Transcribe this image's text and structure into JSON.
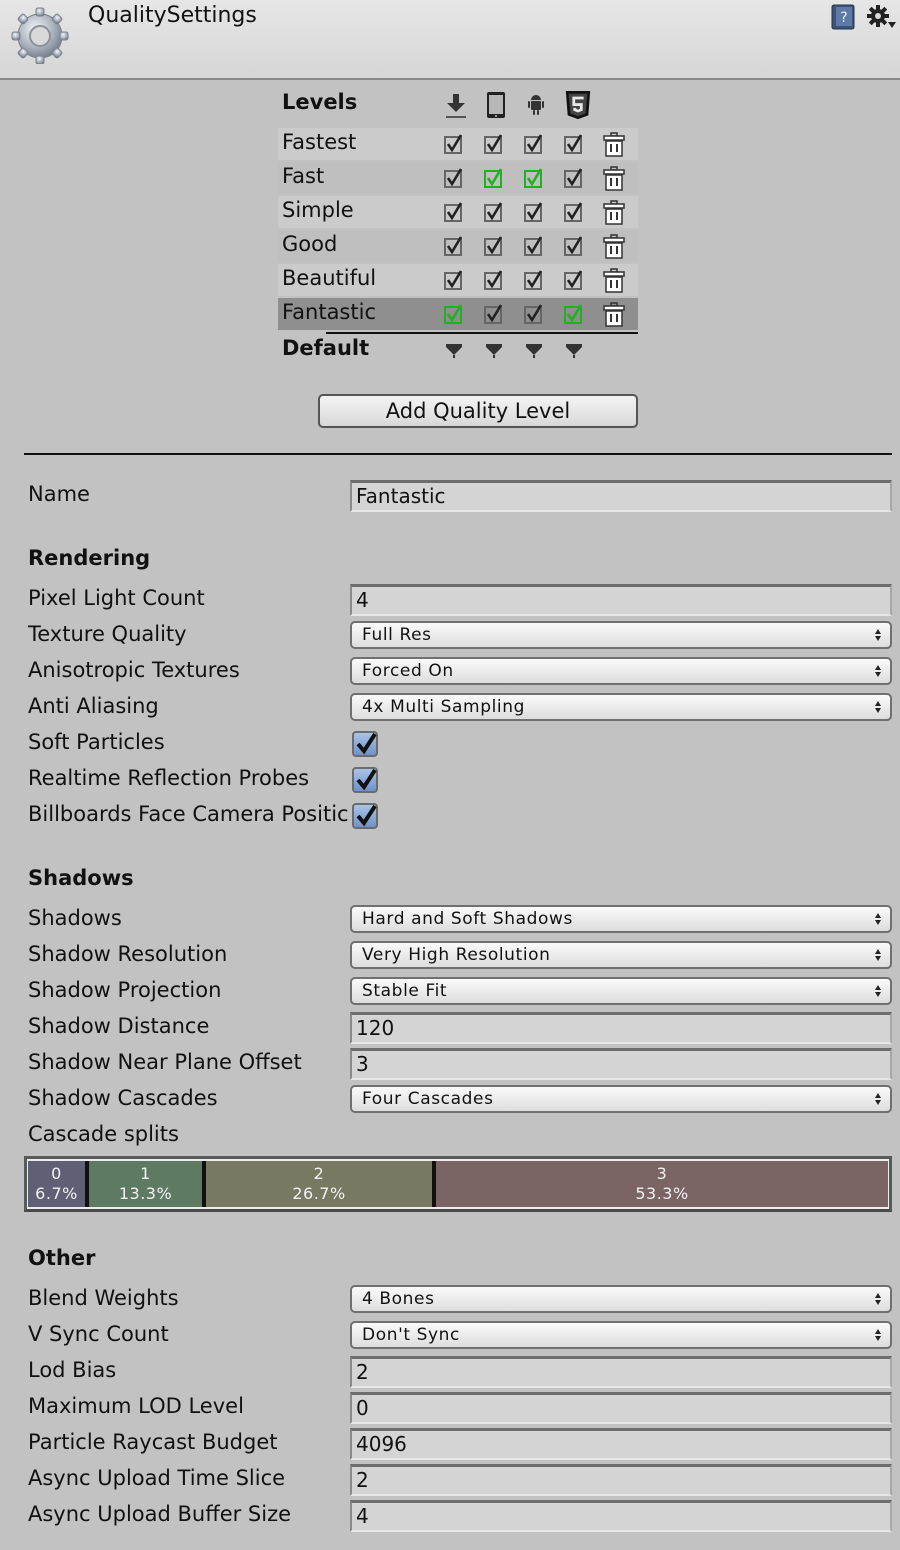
{
  "header": {
    "title": "QualitySettings",
    "icons": [
      "gear-icon",
      "help-book-icon",
      "settings-gear-dropdown-icon"
    ]
  },
  "levels": {
    "header_label": "Levels",
    "platforms": [
      {
        "name": "standalone",
        "icon": "download-arrow-icon"
      },
      {
        "name": "ios",
        "icon": "phone-icon"
      },
      {
        "name": "android",
        "icon": "android-icon"
      },
      {
        "name": "webgl",
        "icon": "html5-icon"
      }
    ],
    "rows": [
      {
        "name": "Fastest",
        "checks": [
          true,
          true,
          true,
          true
        ],
        "green": [
          false,
          false,
          false,
          false
        ],
        "selected": false
      },
      {
        "name": "Fast",
        "checks": [
          true,
          true,
          true,
          true
        ],
        "green": [
          false,
          true,
          true,
          false
        ],
        "selected": false
      },
      {
        "name": "Simple",
        "checks": [
          true,
          true,
          true,
          true
        ],
        "green": [
          false,
          false,
          false,
          false
        ],
        "selected": false
      },
      {
        "name": "Good",
        "checks": [
          true,
          true,
          true,
          true
        ],
        "green": [
          false,
          false,
          false,
          false
        ],
        "selected": false
      },
      {
        "name": "Beautiful",
        "checks": [
          true,
          true,
          true,
          true
        ],
        "green": [
          false,
          false,
          false,
          false
        ],
        "selected": false
      },
      {
        "name": "Fantastic",
        "checks": [
          true,
          true,
          true,
          true
        ],
        "green": [
          true,
          false,
          false,
          true
        ],
        "selected": true
      }
    ],
    "default_label": "Default",
    "add_button": "Add Quality Level"
  },
  "colors": {
    "default_check": "#222222",
    "highlight_check": "#22b022",
    "cascade": [
      "#5f5f75",
      "#5f7a62",
      "#797963",
      "#7a6464"
    ]
  },
  "name": {
    "label": "Name",
    "value": "Fantastic"
  },
  "rendering": {
    "title": "Rendering",
    "pixel_light_count": {
      "label": "Pixel Light Count",
      "value": "4"
    },
    "texture_quality": {
      "label": "Texture Quality",
      "value": "Full Res"
    },
    "anisotropic_textures": {
      "label": "Anisotropic Textures",
      "value": "Forced On"
    },
    "anti_aliasing": {
      "label": "Anti Aliasing",
      "value": "4x Multi Sampling"
    },
    "soft_particles": {
      "label": "Soft Particles",
      "checked": true
    },
    "realtime_reflection_probes": {
      "label": "Realtime Reflection Probes",
      "checked": true
    },
    "billboards_face_camera": {
      "label": "Billboards Face Camera Positic",
      "checked": true
    }
  },
  "shadows": {
    "title": "Shadows",
    "shadows": {
      "label": "Shadows",
      "value": "Hard and Soft Shadows"
    },
    "shadow_resolution": {
      "label": "Shadow Resolution",
      "value": "Very High Resolution"
    },
    "shadow_projection": {
      "label": "Shadow Projection",
      "value": "Stable Fit"
    },
    "shadow_distance": {
      "label": "Shadow Distance",
      "value": "120"
    },
    "shadow_near_plane_offset": {
      "label": "Shadow Near Plane Offset",
      "value": "3"
    },
    "shadow_cascades": {
      "label": "Shadow Cascades",
      "value": "Four Cascades"
    },
    "cascade_splits": {
      "label": "Cascade splits",
      "segments": [
        {
          "index": "0",
          "percent_label": "6.7%",
          "fraction": 0.067
        },
        {
          "index": "1",
          "percent_label": "13.3%",
          "fraction": 0.133
        },
        {
          "index": "2",
          "percent_label": "26.7%",
          "fraction": 0.267
        },
        {
          "index": "3",
          "percent_label": "53.3%",
          "fraction": 0.533
        }
      ]
    }
  },
  "other": {
    "title": "Other",
    "blend_weights": {
      "label": "Blend Weights",
      "value": "4 Bones"
    },
    "v_sync_count": {
      "label": "V Sync Count",
      "value": "Don't Sync"
    },
    "lod_bias": {
      "label": "Lod Bias",
      "value": "2"
    },
    "maximum_lod_level": {
      "label": "Maximum LOD Level",
      "value": "0"
    },
    "particle_raycast_budget": {
      "label": "Particle Raycast Budget",
      "value": "4096"
    },
    "async_upload_time_slice": {
      "label": "Async Upload Time Slice",
      "value": "2"
    },
    "async_upload_buffer_size": {
      "label": "Async Upload Buffer Size",
      "value": "4"
    }
  }
}
